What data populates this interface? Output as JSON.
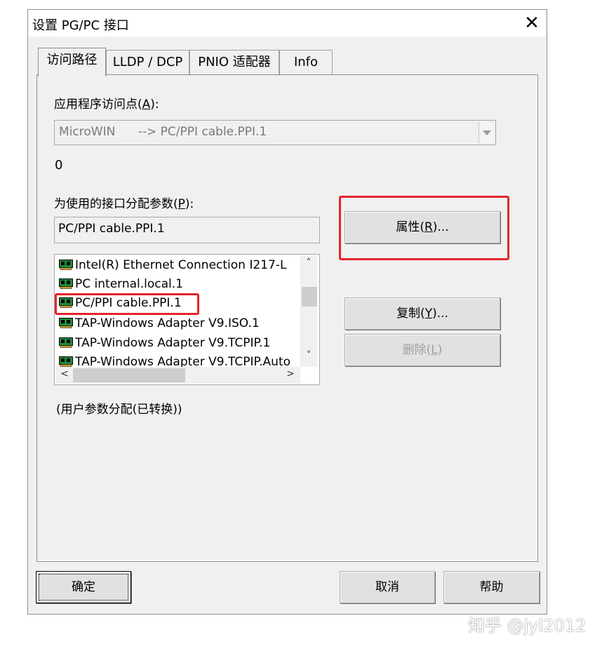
{
  "window": {
    "title": "设置 PG/PC 接口",
    "close_glyph": "✕"
  },
  "tabs": [
    {
      "label": "访问路径",
      "active": true
    },
    {
      "label": "LLDP / DCP",
      "active": false
    },
    {
      "label": "PNIO 适配器",
      "active": false
    },
    {
      "label": "Info",
      "active": false
    }
  ],
  "access_point": {
    "label_prefix": "应用程序访问点(",
    "label_key": "A",
    "label_suffix": "):",
    "value": "MicroWIN      --> PC/PPI cable.PPI.1",
    "sub_value": "0"
  },
  "interface_params": {
    "label_prefix": "为使用的接口分配参数(",
    "label_key": "P",
    "label_suffix": "):",
    "value": "PC/PPI cable.PPI.1",
    "items": [
      "Intel(R) Ethernet Connection I217-L",
      "PC internal.local.1",
      "PC/PPI cable.PPI.1",
      "TAP-Windows Adapter V9.ISO.1",
      "TAP-Windows Adapter V9.TCPIP.1",
      "TAP-Windows Adapter V9.TCPIP.Auto"
    ],
    "selected_index": 2,
    "status_text": "(用户参数分配(已转换))"
  },
  "buttons": {
    "properties": {
      "prefix": "属性(",
      "key": "R",
      "suffix": ")..."
    },
    "copy": {
      "prefix": "复制(",
      "key": "Y",
      "suffix": ")..."
    },
    "delete": {
      "prefix": "删除(",
      "key": "L",
      "suffix": ")",
      "enabled": false
    },
    "ok": "确定",
    "cancel": "取消",
    "help": "帮助"
  },
  "scroll_glyphs": {
    "up": "˄",
    "down": "˅",
    "left": "<",
    "right": ">"
  },
  "highlight_color": "#e3242b",
  "watermark": "知乎 @jyl2012"
}
